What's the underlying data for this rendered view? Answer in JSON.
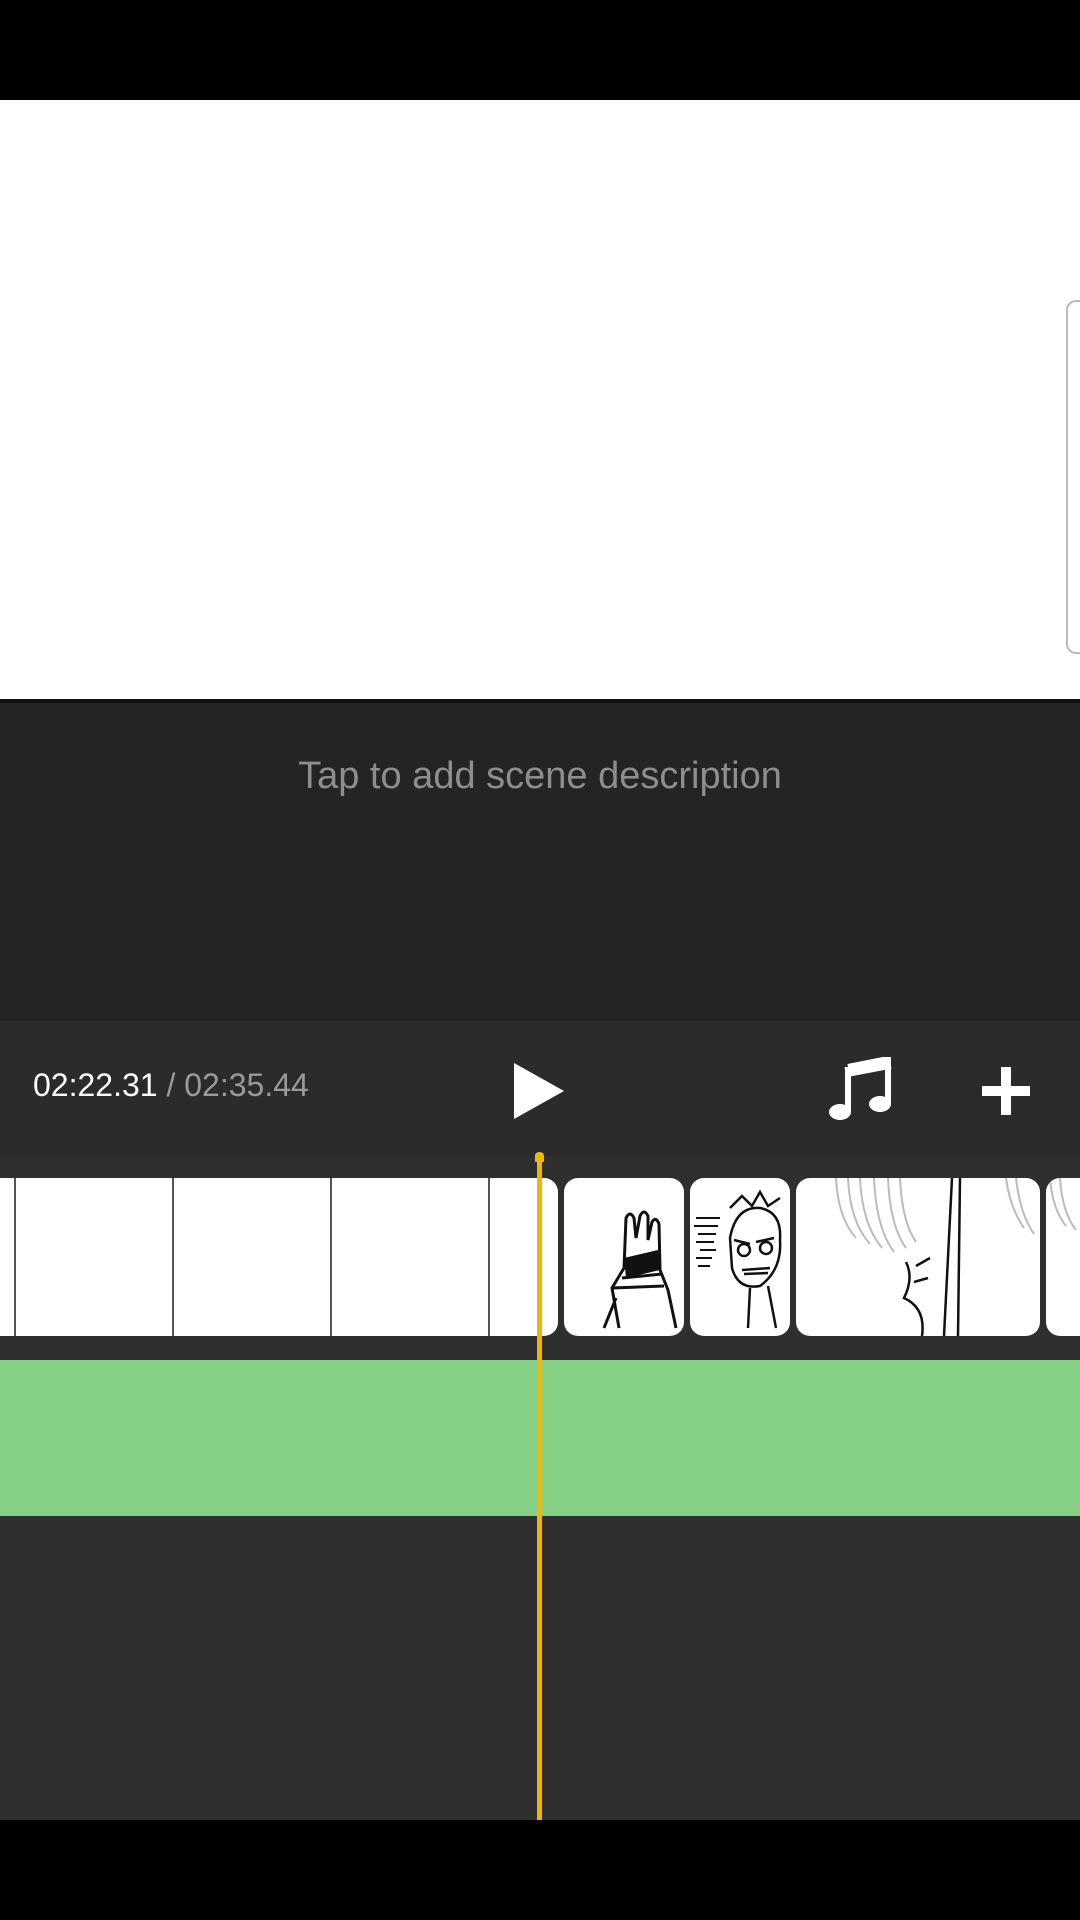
{
  "scene": {
    "description_placeholder": "Tap to add scene description"
  },
  "playback": {
    "current_time": "02:22.31",
    "separator": " / ",
    "total_time": "02:35.44"
  },
  "controls": {
    "play_icon": "play-icon",
    "music_icon": "music-note-icon",
    "add_icon": "plus-icon"
  },
  "timeline": {
    "audio_track_color": "#86d186",
    "playhead_color": "#f2b600",
    "frames": [
      {
        "kind": "blank"
      },
      {
        "kind": "blank"
      },
      {
        "kind": "blank"
      },
      {
        "kind": "blank"
      },
      {
        "kind": "sketch",
        "subject": "raised-hand"
      },
      {
        "kind": "sketch",
        "subject": "character-face"
      },
      {
        "kind": "sketch",
        "subject": "hair-closeup"
      },
      {
        "kind": "sketch",
        "subject": "hair-partial"
      }
    ]
  },
  "colors": {
    "background": "#242424",
    "controls_bar": "#2b2b2b",
    "timeline_bg": "#2f2f2f"
  }
}
